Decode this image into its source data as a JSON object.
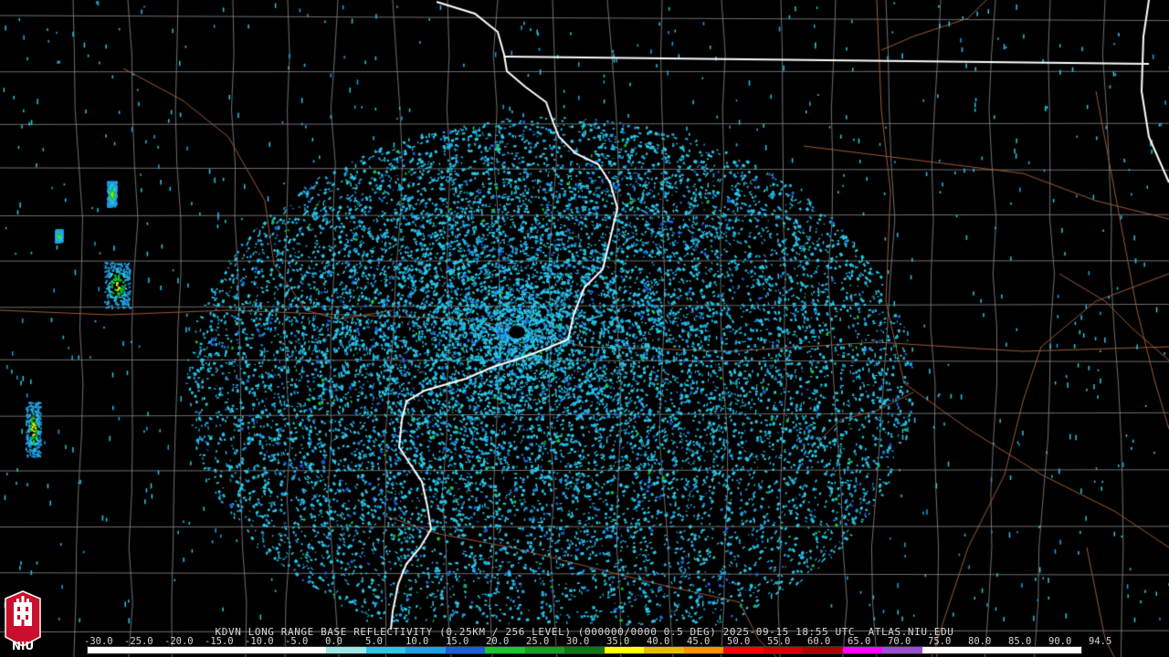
{
  "caption": "KDVN LONG RANGE BASE REFLECTIVITY (0.25KM / 256 LEVEL) (000000/0000 0.5 DEG) 2025-09-15 18:55 UTC  ATLAS.NIU.EDU",
  "scale": {
    "labels": [
      "-30.0",
      "-25.0",
      "-20.0",
      "-15.0",
      "-10.0",
      "-5.0",
      "0.0",
      "5.0",
      "10.0",
      "15.0",
      "20.0",
      "25.0",
      "30.0",
      "35.0",
      "40.0",
      "45.0",
      "50.0",
      "55.0",
      "60.0",
      "65.0",
      "70.0",
      "75.0",
      "80.0",
      "85.0",
      "90.0",
      "94.5"
    ],
    "colors": [
      "#ffffff",
      "#ffffff",
      "#ffffff",
      "#ffffff",
      "#ffffff",
      "#ffffff",
      "#9fe6e6",
      "#29c8e8",
      "#1ea0e6",
      "#1b5fe0",
      "#17c830",
      "#15a020",
      "#0c7a10",
      "#ffff00",
      "#e6c000",
      "#ff9000",
      "#ff0000",
      "#d40000",
      "#b00000",
      "#ff00ff",
      "#9b4fd0",
      "#ffffff",
      "#ffffff",
      "#ffffff",
      "#ffffff"
    ]
  },
  "logo": {
    "text": "NIU",
    "name": "niu-logo"
  },
  "map": {
    "radar_site": "KDVN",
    "state_border_color": "#ffffff",
    "county_line_color": "#8a8a8a",
    "highway_color": "#9a5a3a",
    "echo_colors": [
      "#29c8e8",
      "#1ea0e6",
      "#1b5fe0",
      "#17c830",
      "#e6e600"
    ]
  }
}
